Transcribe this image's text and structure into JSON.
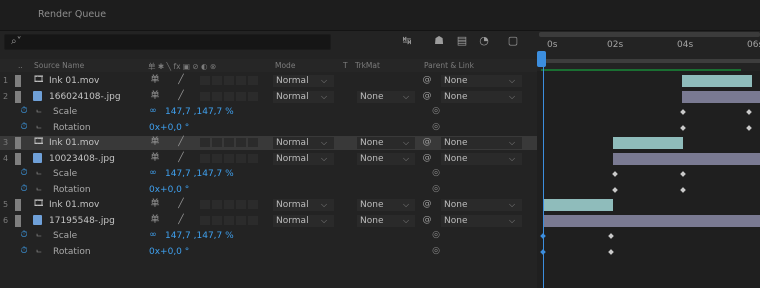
{
  "panel": {
    "title": "Render Queue"
  },
  "search": {
    "icon": "search-icon",
    "placeholder": ""
  },
  "columns": {
    "source_name": "Source Name",
    "switches": "单 ✱ ╲ fx ▣ ⊘ ◐ ⊗",
    "mode": "Mode",
    "t": "T",
    "trkmat": "TrkMat",
    "parent": "Parent & Link"
  },
  "rows": [
    {
      "kind": "layer",
      "index": "1",
      "name": "Ink 01.mov",
      "file": "video",
      "mode": "Normal",
      "trkmat": "",
      "parent": "None",
      "label_color": "#7f7f7f"
    },
    {
      "kind": "layer",
      "index": "2",
      "name": "166024108-.jpg",
      "file": "image",
      "mode": "Normal",
      "trkmat": "None",
      "parent": "None",
      "label_color": "#7f7f7f"
    },
    {
      "kind": "prop",
      "name": "Scale",
      "value": "147,7 ,147,7 %"
    },
    {
      "kind": "prop",
      "name": "Rotation",
      "value": "0x+0,0 °"
    },
    {
      "kind": "layer",
      "index": "3",
      "name": "Ink 01.mov",
      "file": "video",
      "mode": "Normal",
      "trkmat": "None",
      "parent": "None",
      "label_color": "#7f7f7f",
      "selected": true
    },
    {
      "kind": "layer",
      "index": "4",
      "name": "10023408-.jpg",
      "file": "image",
      "mode": "Normal",
      "trkmat": "None",
      "parent": "None",
      "label_color": "#7f7f7f"
    },
    {
      "kind": "prop",
      "name": "Scale",
      "value": "147,7 ,147,7 %"
    },
    {
      "kind": "prop",
      "name": "Rotation",
      "value": "0x+0,0 °"
    },
    {
      "kind": "layer",
      "index": "5",
      "name": "Ink 01.mov",
      "file": "video",
      "mode": "Normal",
      "trkmat": "None",
      "parent": "None",
      "label_color": "#7f7f7f"
    },
    {
      "kind": "layer",
      "index": "6",
      "name": "17195548-.jpg",
      "file": "image",
      "mode": "Normal",
      "trkmat": "None",
      "parent": "None",
      "label_color": "#7f7f7f"
    },
    {
      "kind": "prop",
      "name": "Scale",
      "value": "147,7 ,147,7 %"
    },
    {
      "kind": "prop",
      "name": "Rotation",
      "value": "0x+0,0 °"
    }
  ],
  "timeline": {
    "ticks": [
      "0s",
      "02s",
      "04s",
      "06s"
    ],
    "accent": "#3c8ede",
    "clip_video_color": "#8fbcbb",
    "clip_image_color": "#7a7a92"
  }
}
